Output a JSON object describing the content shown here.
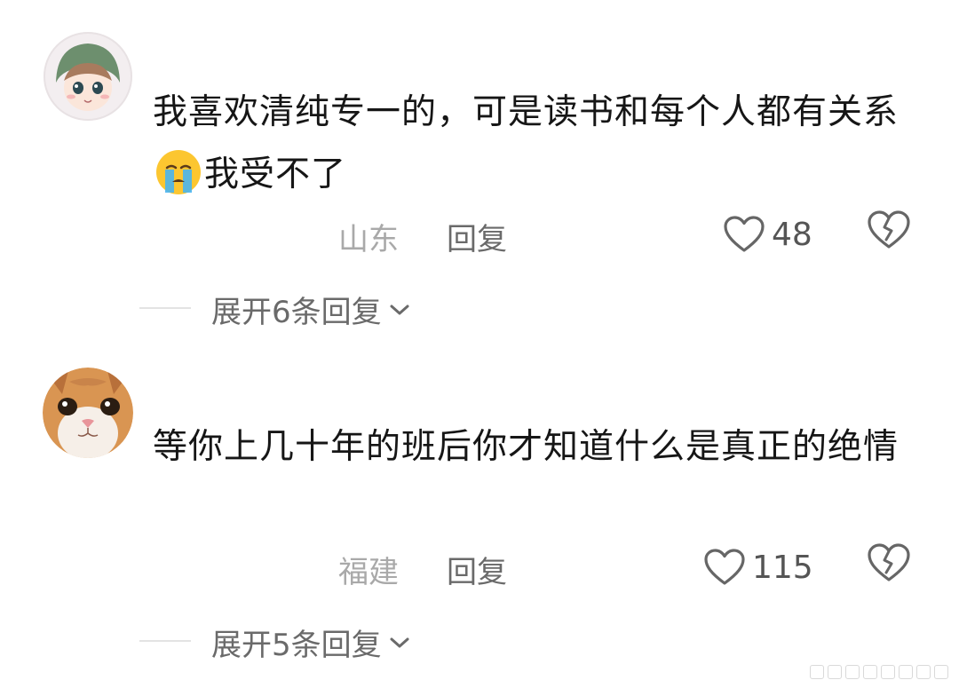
{
  "comments": [
    {
      "avatar": "anime-avatar-icon",
      "text_before_emoji": "我喜欢清纯专一的，可是读书和每个人都有关系",
      "emoji": "crying-face-emoji",
      "text_after_emoji": "我受不了",
      "location": "山东",
      "reply_label": "回复",
      "like_count": "48",
      "expand_label": "展开6条回复"
    },
    {
      "avatar": "cat-avatar-icon",
      "text": "等你上几十年的班后你才知道什么是真正的绝情",
      "location": "福建",
      "reply_label": "回复",
      "like_count": "115",
      "expand_label": "展开5条回复"
    }
  ],
  "colors": {
    "text": "#161616",
    "meta_location": "#a9a9a9",
    "meta_action": "#6a6a6a",
    "icon": "#666666"
  }
}
